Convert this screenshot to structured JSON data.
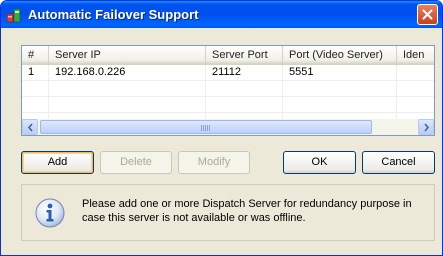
{
  "window": {
    "title": "Automatic Failover Support"
  },
  "list": {
    "columns": [
      "#",
      "Server IP",
      "Server Port",
      "Port (Video Server)",
      "Iden"
    ],
    "rows": [
      [
        "1",
        "192.168.0.226",
        "21112",
        "5551"
      ]
    ]
  },
  "buttons": {
    "add": "Add",
    "delete": "Delete",
    "modify": "Modify",
    "ok": "OK",
    "cancel": "Cancel"
  },
  "info": {
    "message": "Please add one or more Dispatch Server for redundancy purpose in case this server is not available or was offline."
  },
  "icons": {
    "app": "app-network-icon",
    "close": "close-icon",
    "info": "info-icon",
    "scroll_left": "arrow-left-icon",
    "scroll_right": "arrow-right-icon"
  },
  "colors": {
    "titlebar": "#0053ee",
    "close_button": "#c8401f",
    "window_bg": "#ece9d8",
    "info_icon": "#2b5fb0"
  }
}
